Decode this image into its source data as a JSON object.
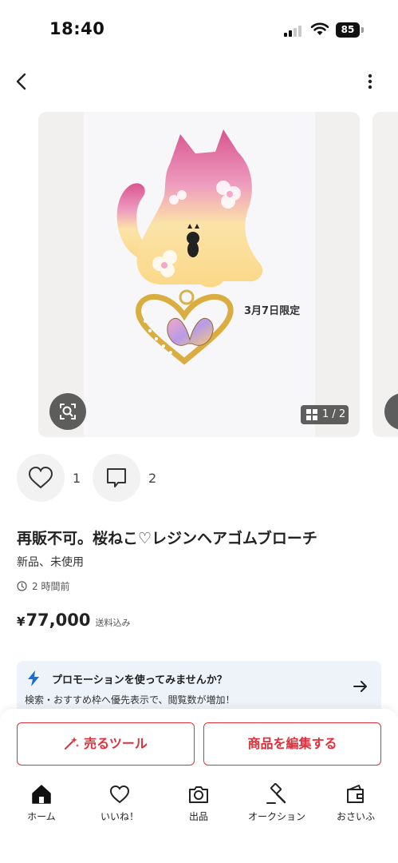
{
  "status_bar": {
    "time": "18:40",
    "battery": "85"
  },
  "gallery": {
    "page_indicator": "1 / 2",
    "overlay_label": "3月7日限定"
  },
  "actions": {
    "like_count": "1",
    "comment_count": "2"
  },
  "item": {
    "title": "再販不可。桜ねこ♡レジンヘアゴムブローチ",
    "condition": "新品、未使用",
    "posted": "2 時間前",
    "currency": "¥",
    "price": "77,000",
    "shipping": "送料込み"
  },
  "promo": {
    "title": "プロモーションを使ってみませんか？",
    "description": "検索・おすすめ枠へ優先表示で、閲覧数が増加！"
  },
  "buttons": {
    "sell_tool": "売るツール",
    "edit_item": "商品を編集する"
  },
  "tabs": [
    {
      "label": "ホーム",
      "icon": "home-icon"
    },
    {
      "label": "いいね！",
      "icon": "heart-icon"
    },
    {
      "label": "出品",
      "icon": "camera-icon"
    },
    {
      "label": "オークション",
      "icon": "gavel-icon"
    },
    {
      "label": "おさいふ",
      "icon": "wallet-icon"
    }
  ],
  "colors": {
    "accent": "#e0303b",
    "promo_bg": "#eef3f9",
    "bolt": "#1a6fd6"
  }
}
